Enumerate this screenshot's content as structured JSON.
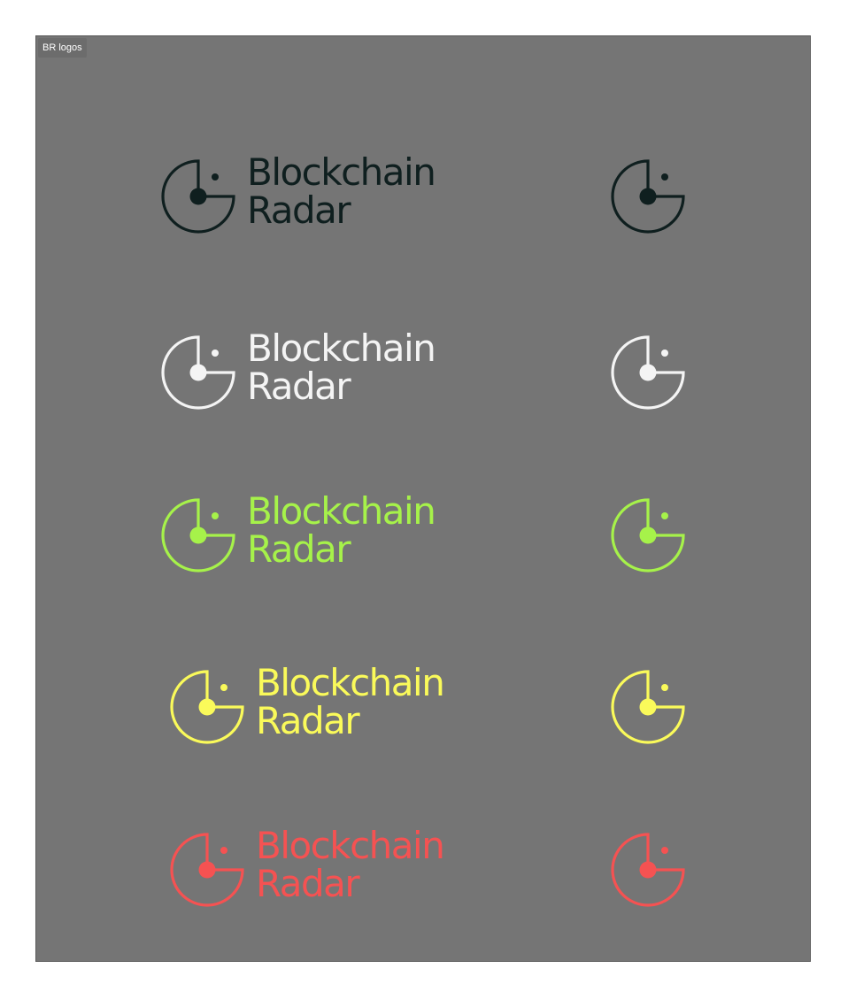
{
  "frame": {
    "label": "BR logos",
    "background": "#757575"
  },
  "brand": {
    "line1": "Blockchain",
    "line2": "Radar"
  },
  "variants": [
    {
      "name": "dark",
      "color": "#0f1f1f"
    },
    {
      "name": "white",
      "color": "#f4f4f4"
    },
    {
      "name": "green",
      "color": "#a6f24a"
    },
    {
      "name": "yellow",
      "color": "#fafa5a"
    },
    {
      "name": "red",
      "color": "#f55252"
    }
  ],
  "icons": {
    "mark": "radar-logo-icon"
  }
}
